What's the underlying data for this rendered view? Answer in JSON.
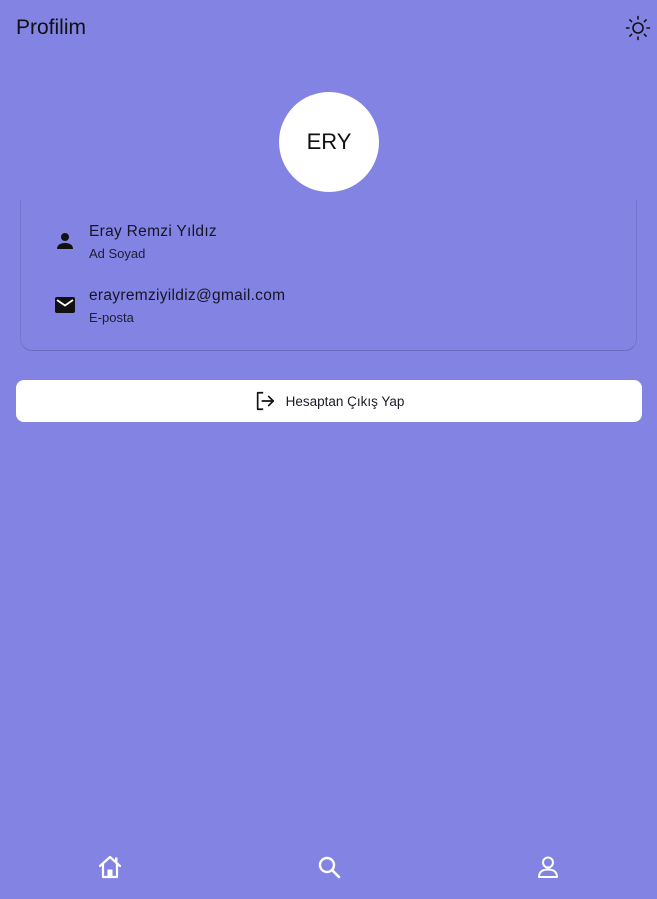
{
  "app_bar": {
    "title": "Profilim",
    "theme_icon": "sun-icon"
  },
  "avatar": {
    "initials": "ERY"
  },
  "profile_info": {
    "name": {
      "icon": "person-icon",
      "value": "Eray Remzi Yıldız",
      "label": "Ad Soyad"
    },
    "email": {
      "icon": "mail-icon",
      "value": "erayremziyildiz@gmail.com",
      "label": "E-posta"
    }
  },
  "logout": {
    "icon": "logout-icon",
    "label": "Hesaptan Çıkış Yap"
  },
  "bottom_nav": {
    "items": [
      {
        "icon": "home-icon"
      },
      {
        "icon": "search-icon"
      },
      {
        "icon": "profile-icon"
      }
    ]
  },
  "colors": {
    "background": "#8383e3",
    "surface": "#ffffff",
    "text": "#111111"
  }
}
